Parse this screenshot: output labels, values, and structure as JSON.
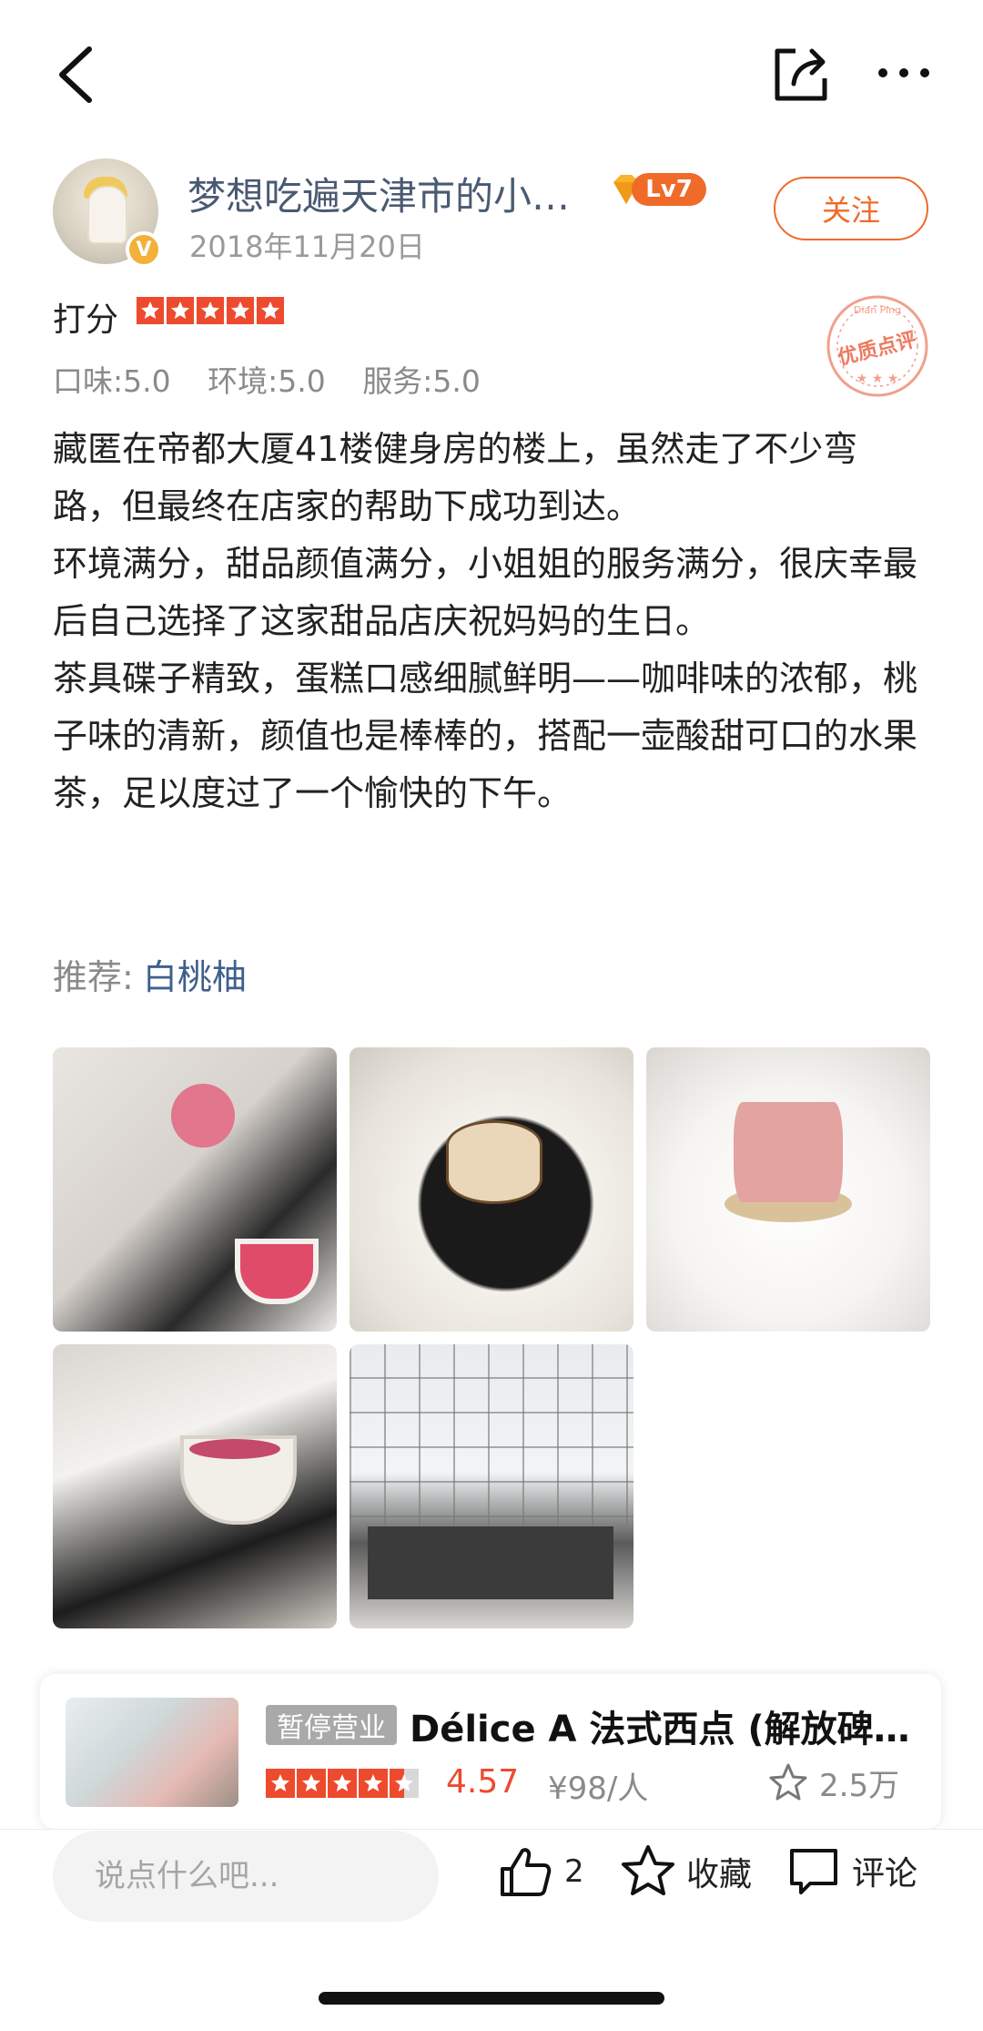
{
  "author": {
    "name": "梦想吃遍天津市的小…",
    "level": "Lv7",
    "verified_mark": "V",
    "date": "2018年11月20日",
    "follow_label": "关注"
  },
  "rating": {
    "label": "打分",
    "stars": 5,
    "taste": "口味:5.0",
    "environment": "环境:5.0",
    "service": "服务:5.0",
    "stamp_text": "优质点评",
    "stamp_sub": "Dian Ping"
  },
  "review": {
    "paragraphs": [
      "藏匿在帝都大厦41楼健身房的楼上，虽然走了不少弯路，但最终在店家的帮助下成功到达。",
      "环境满分，甜品颜值满分，小姐姐的服务满分，很庆幸最后自己选择了这家甜品店庆祝妈妈的生日。",
      "茶具碟子精致，蛋糕口感细腻鲜明——咖啡味的浓郁，桃子味的清新，颜值也是棒棒的，搭配一壶酸甜可口的水果茶，足以度过了一个愉快的下午。"
    ],
    "recommend_label": "推荐:",
    "recommend_dish": "白桃柚"
  },
  "shop": {
    "status": "暂停营业",
    "name": "Délice A 法式西点 (解放碑…",
    "rating": 4.5,
    "score": "4.57",
    "price": "¥98/人",
    "favorites": "2.5万"
  },
  "bottom": {
    "comment_placeholder": "说点什么吧...",
    "like_count": "2",
    "collect_label": "收藏",
    "comment_label": "评论"
  },
  "icons": {
    "back": "back-arrow-icon",
    "share": "share-icon",
    "more": "more-icon",
    "like": "thumbs-up-icon",
    "collect": "star-icon",
    "comment": "comment-icon"
  },
  "colors": {
    "accent": "#f06a2a",
    "star": "#ee4a2e",
    "link": "#3f5f8c",
    "name": "#4a5a72"
  }
}
